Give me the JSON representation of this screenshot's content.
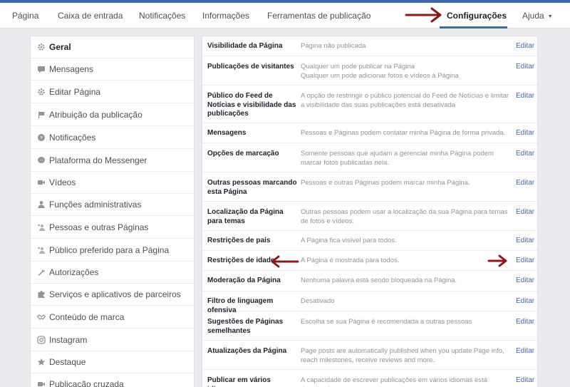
{
  "nav": {
    "tabs": [
      "Página",
      "Caixa de entrada",
      "Notificações",
      "Informações",
      "Ferramentas de publicação"
    ],
    "active": "Configurações",
    "help": "Ajuda",
    "accent": "#4267b2"
  },
  "sidebar": {
    "items": [
      {
        "label": "Geral",
        "icon": "gear-icon"
      },
      {
        "label": "Mensagens",
        "icon": "message-icon"
      },
      {
        "label": "Editar Página",
        "icon": "gear-icon"
      },
      {
        "label": "Atribuição da publicação",
        "icon": "flag-icon"
      },
      {
        "label": "Notificações",
        "icon": "globe-icon"
      },
      {
        "label": "Plataforma do Messenger",
        "icon": "messenger-icon"
      },
      {
        "label": "Vídeos",
        "icon": "video-camera-icon"
      },
      {
        "label": "Funções administrativas",
        "icon": "person-icon"
      },
      {
        "label": "Pessoas e outras Páginas",
        "icon": "person-star-icon"
      },
      {
        "label": "Público preferido para a Página",
        "icon": "person-star-icon"
      },
      {
        "label": "Autorizações",
        "icon": "wrench-icon"
      },
      {
        "label": "Serviços e aplicativos de parceiros",
        "icon": "puzzle-icon"
      },
      {
        "label": "Conteúdo de marca",
        "icon": "handshake-icon"
      },
      {
        "label": "Instagram",
        "icon": "instagram-icon"
      },
      {
        "label": "Destaque",
        "icon": "star-icon"
      },
      {
        "label": "Publicação cruzada",
        "icon": "video-camera-icon"
      }
    ]
  },
  "settings": {
    "edit_label": "Editar",
    "rows": [
      {
        "title": "Visibilidade da Página",
        "desc": "Página não publicada"
      },
      {
        "title": "Publicações de visitantes",
        "desc": "Qualquer um pode publicar na Página\nQualquer um pode adicionar fotos e vídeos à Página"
      },
      {
        "title": "Público do Feed de Notícias e visibilidade das publicações",
        "desc": "A opção de restringir o público potencial do Feed de Notícias e limitar a visibilidade das suas publicações está desativada"
      },
      {
        "title": "Mensagens",
        "desc": "Pessoas e Páginas podem contatar minha Página de forma privada."
      },
      {
        "title": "Opções de marcação",
        "desc": "Somente pessoas que ajudam a gerenciar minha Página podem marcar fotos publicadas nela."
      },
      {
        "title": "Outras pessoas marcando esta Página",
        "desc": "Pessoas e outras Páginas podem marcar minha Página."
      },
      {
        "title": "Localização da Página para temas",
        "desc": "Outras pessoas podem usar a localização da sua Página para temas de fotos e vídeos."
      },
      {
        "title": "Restrições de país",
        "desc": "A Página fica visível para todos."
      },
      {
        "title": "Restrições de idade",
        "desc": "A Página é mostrada para todos."
      },
      {
        "title": "Moderação da Página",
        "desc": "Nenhuma palavra está sendo bloqueada na Página."
      },
      {
        "title": "Filtro de linguagem ofensiva",
        "desc": "Desativado"
      },
      {
        "title": "Sugestões de Páginas semelhantes",
        "desc": "Escolha se sua Página é recomendada a outras pessoas"
      },
      {
        "title": "Atualizações da Página",
        "desc": "Page posts are automatically published when you update Page info, reach milestones, receive reviews and more."
      },
      {
        "title": "Publicar em vários idiomas",
        "desc": "A capacidade de escrever publicações em vários idiomas está desativada"
      }
    ]
  },
  "annotation_color": "#8b1a1a"
}
